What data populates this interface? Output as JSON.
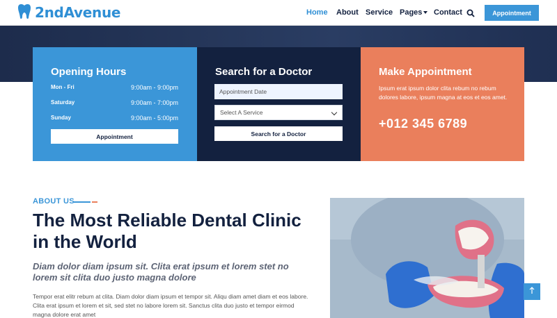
{
  "brand": {
    "name": "2ndAvenue",
    "icon": "tooth-icon"
  },
  "nav": {
    "items": [
      {
        "label": "Home",
        "active": true
      },
      {
        "label": "About"
      },
      {
        "label": "Service"
      },
      {
        "label": "Pages"
      },
      {
        "label": "Contact"
      }
    ],
    "search_icon": "search-icon",
    "cta_label": "Appointment"
  },
  "hours": {
    "title": "Opening Hours",
    "rows": [
      {
        "day": "Mon - Fri",
        "time": "9:00am - 9:00pm"
      },
      {
        "day": "Saturday",
        "time": "9:00am - 7:00pm"
      },
      {
        "day": "Sunday",
        "time": "9:00am - 5:00pm"
      }
    ],
    "button_label": "Appointment"
  },
  "search": {
    "title": "Search for a Doctor",
    "date_placeholder": "Appointment Date",
    "service_selected": "Select A Service",
    "button_label": "Search for a Doctor"
  },
  "appointment": {
    "title": "Make Appointment",
    "text": "Ipsum erat ipsum dolor clita rebum no rebum dolores labore, ipsum magna at eos et eos amet.",
    "phone": "+012 345 6789"
  },
  "about": {
    "label": "ABOUT US",
    "title": "The Most Reliable Dental Clinic in the World",
    "subtitle": "Diam dolor diam ipsum sit. Clita erat ipsum et lorem stet no lorem sit clita duo justo magna dolore",
    "body": "Tempor erat elitr rebum at clita. Diam dolor diam ipsum et tempor sit. Aliqu diam amet diam et eos labore. Clita erat ipsum et lorem et sit, sed stet no labore lorem sit. Sanctus clita duo justo et tempor eirmod magna dolore erat amet"
  },
  "colors": {
    "primary": "#3b96d8",
    "dark": "#13213f",
    "accent": "#ea7f5c"
  },
  "scroll_top_icon": "arrow-up-icon"
}
